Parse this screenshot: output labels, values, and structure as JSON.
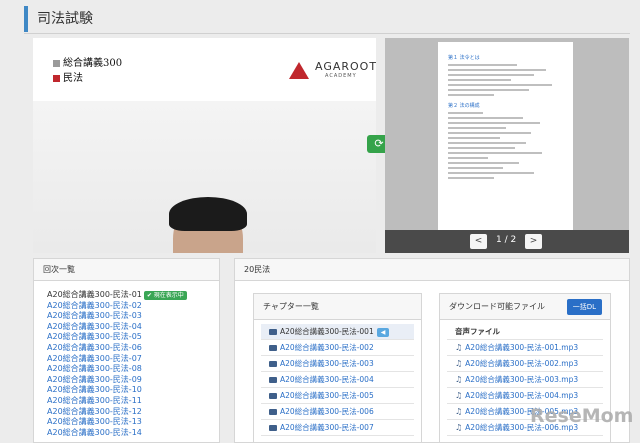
{
  "header": {
    "title": "司法試験"
  },
  "video": {
    "label1": "総合講義300",
    "label2": "民法",
    "label1_color": "#9a9a9a",
    "label2_color": "#c0272d",
    "logo_text": "AGAROOT",
    "logo_sub": "ACADEMY"
  },
  "sync_icon": "refresh-icon",
  "viewer": {
    "doc_heading1": "第１ 法令とは",
    "doc_heading2": "第２ 法の構成",
    "pager_prev": "<",
    "pager_next": ">",
    "pager_text": "1 / 2"
  },
  "episodes": {
    "title": "回次一覧",
    "current_badge": "✔ 現在表示中",
    "items": [
      "A20総合講義300-民法-01",
      "A20総合講義300-民法-02",
      "A20総合講義300-民法-03",
      "A20総合講義300-民法-04",
      "A20総合講義300-民法-05",
      "A20総合講義300-民法-06",
      "A20総合講義300-民法-07",
      "A20総合講義300-民法-08",
      "A20総合講義300-民法-09",
      "A20総合講義300-民法-10",
      "A20総合講義300-民法-11",
      "A20総合講義300-民法-12",
      "A20総合講義300-民法-13",
      "A20総合講義300-民法-14"
    ]
  },
  "detail": {
    "title": "20民法",
    "chapters": {
      "title": "チャプター一覧",
      "play_badge": "◀",
      "items": [
        "A20総合講義300-民法-001",
        "A20総合講義300-民法-002",
        "A20総合講義300-民法-003",
        "A20総合講義300-民法-004",
        "A20総合講義300-民法-005",
        "A20総合講義300-民法-006",
        "A20総合講義300-民法-007"
      ]
    },
    "downloads": {
      "title": "ダウンロード可能ファイル",
      "bulk_button": "一括DL",
      "section": "音声ファイル",
      "items": [
        "A20総合講義300-民法-001.mp3",
        "A20総合講義300-民法-002.mp3",
        "A20総合講義300-民法-003.mp3",
        "A20総合講義300-民法-004.mp3",
        "A20総合講義300-民法-005.mp3",
        "A20総合講義300-民法-006.mp3"
      ]
    }
  },
  "watermark": "ReseMom"
}
